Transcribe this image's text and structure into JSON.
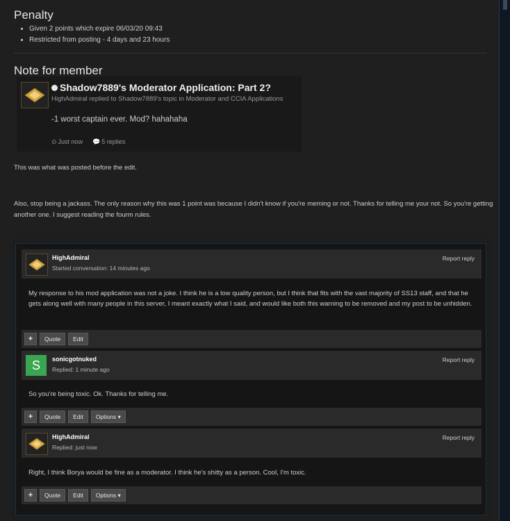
{
  "penalty": {
    "heading": "Penalty",
    "items": [
      "Given 2 points which expire 06/03/20 09:43",
      "Restricted from posting - 4 days and 23 hours"
    ]
  },
  "note": {
    "heading": "Note for member",
    "quote": {
      "title": "Shadow7889's Moderator Application: Part 2?",
      "subtitle": "HighAdmiral replied to Shadow7889's topic in Moderator and CCIA Applications",
      "body": "-1 worst captain ever. Mod? hahahaha",
      "time": "Just now",
      "replies": "5 replies"
    },
    "text1": "This was what was posted before the edit.",
    "text2": "Also, stop being a jackass. The only reason why this was 1 point was because I didn't know if you're meming or not. Thanks for telling me your not. So you're getting another one. I suggest reading the fourm rules."
  },
  "posts": [
    {
      "author": "HighAdmiral",
      "status": "Started conversation: 14 minutes ago",
      "report": "Report reply",
      "body": "My response to his mod application was not a joke. I think he is a low quality person, but I think that fits with the vast majority of SS13 staff, and that he gets along well with many people in this server, I meant exactly what I said, and would like both this warning to be removed and my post to be unhidden.",
      "avatar": "gold-insignia"
    },
    {
      "author": "sonicgotnuked",
      "status": "Replied: 1 minute ago",
      "report": "Report reply",
      "body": "So you're being toxic. Ok. Thanks for telling me.",
      "avatar_letter": "S"
    },
    {
      "author": "HighAdmiral",
      "status": "Replied: just now",
      "report": "Report reply",
      "body": "Right, I think Borya would be fine as a moderator. I think he's shitty as a person. Cool, I'm toxic.",
      "avatar": "gold-insignia"
    }
  ],
  "buttons": {
    "plus": "+",
    "quote": "Quote",
    "edit": "Edit",
    "options": "Options ▾"
  },
  "colors": {
    "background": "#1f1f1f",
    "avatar_green": "#3aa652",
    "insignia_gold": "#d4a640"
  }
}
